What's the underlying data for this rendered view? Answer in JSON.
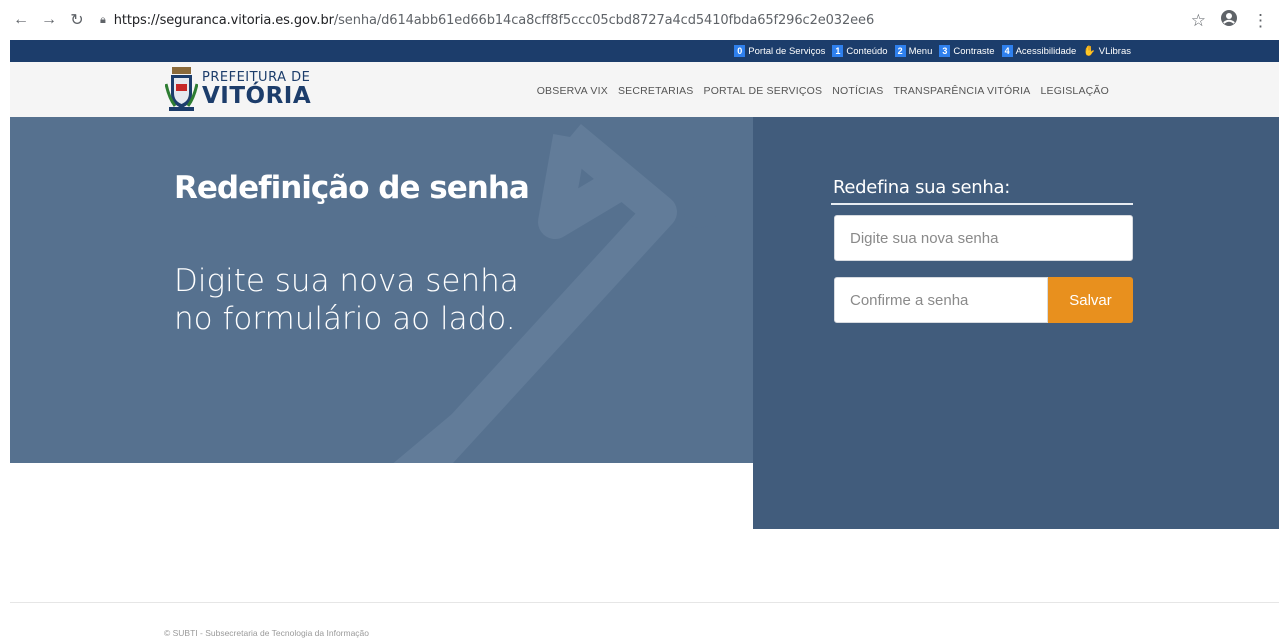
{
  "browser": {
    "url_host": "https://seguranca.vitoria.es.gov.br",
    "url_path": "/senha/d614abb61ed66b14ca8cff8f5ccc05cbd8727a4cd5410fbda65f296c2e032ee6"
  },
  "accessibility_bar": {
    "items": [
      {
        "num": "0",
        "label": "Portal de Serviços"
      },
      {
        "num": "1",
        "label": "Conteúdo"
      },
      {
        "num": "2",
        "label": "Menu"
      },
      {
        "num": "3",
        "label": "Contraste"
      },
      {
        "num": "4",
        "label": "Acessibilidade"
      }
    ],
    "vlibras": "VLibras"
  },
  "header": {
    "logo_small": "PREFEITURA DE",
    "logo_big": "VITÓRIA",
    "menu": [
      "OBSERVA VIX",
      "SECRETARIAS",
      "PORTAL DE SERVIÇOS",
      "NOTÍCIAS",
      "TRANSPARÊNCIA VITÓRIA",
      "LEGISLAÇÃO"
    ]
  },
  "hero": {
    "title": "Redefinição de senha",
    "subtitle": "Digite sua nova senha no formulário ao lado."
  },
  "form": {
    "title": "Redefina sua senha:",
    "new_password_placeholder": "Digite sua nova senha",
    "confirm_placeholder": "Confirme a senha",
    "save_label": "Salvar"
  },
  "footer": {
    "text": "© SUBTI - Subsecretaria de Tecnologia da Informação"
  },
  "colors": {
    "hero_bg": "#56718f",
    "panel_bg": "#415c7c",
    "accent": "#e8901e",
    "topbar": "#1c3d6b"
  }
}
